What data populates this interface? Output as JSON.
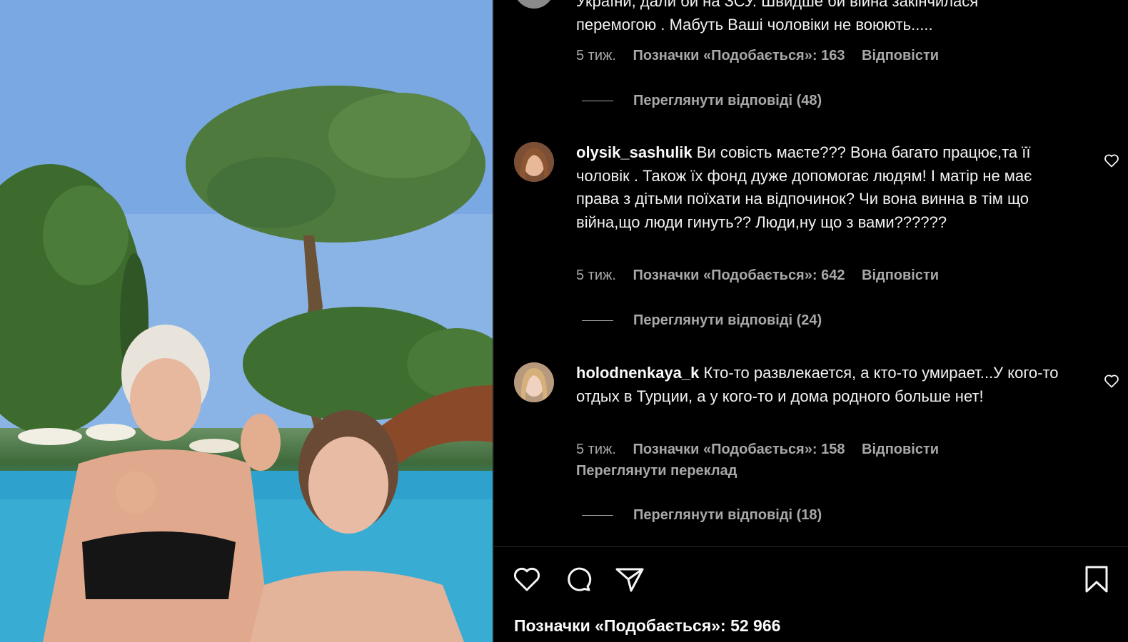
{
  "media": {
    "alt_scene": "photo"
  },
  "comments": [
    {
      "username": "",
      "text_partial": "України, дали бй на ЗСУ. Швидше би війна закінчилася перемогою . Мабуть Ваші чоловіки не воюють.....",
      "line1": "України, дали би на ЗСУ. Швидше би війна закінчилася",
      "line2": "перемогою . Мабуть Ваші чоловіки не воюють.....",
      "time": "5 тиж.",
      "likes": "Позначки «Подобається»: 163",
      "reply": "Відповісти",
      "view_replies": "Переглянути відповіді (48)"
    },
    {
      "username": "olysik_sashulik",
      "text": "Ви совість маєте??? Вона багато працює,та її чоловік . Також їх фонд дуже допомогає людям! І матір не має права з дітьми поїхати на відпочинок? Чи вона винна в тім що війна,що люди гинуть?? Люди,ну що з вами??????",
      "time": "5 тиж.",
      "likes": "Позначки «Подобається»: 642",
      "reply": "Відповісти",
      "view_replies": "Переглянути відповіді (24)"
    },
    {
      "username": "holodnenkaya_k",
      "text": "Кто-то развлекается, а кто-то умирает...У кого-то отдых в Турции, а у кого-то и дома родного больше нет!",
      "time": "5 тиж.",
      "likes": "Позначки «Подобається»: 158",
      "reply": "Відповісти",
      "translate": "Переглянути переклад",
      "view_replies": "Переглянути відповіді (18)"
    }
  ],
  "footer": {
    "likes_total": "Позначки «Подобається»: 52 966",
    "icons": [
      "heart-icon",
      "comment-icon",
      "share-icon",
      "bookmark-icon"
    ]
  },
  "colors": {
    "background": "#000000",
    "text": "#f5f5f5",
    "meta": "#a8a8a8"
  }
}
